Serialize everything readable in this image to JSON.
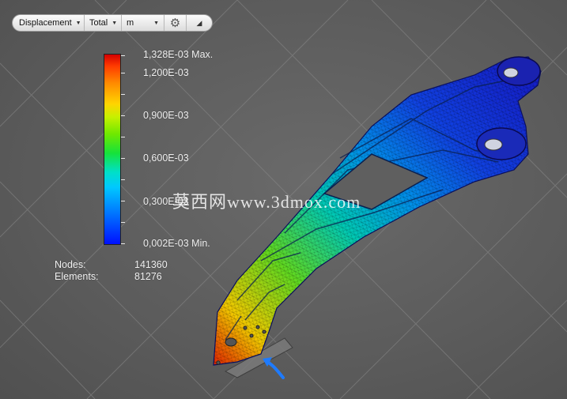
{
  "toolbar": {
    "quantity": "Displacement",
    "component": "Total",
    "unit": "m",
    "settings_icon": "gear-icon",
    "collapse_icon": "triangle-icon"
  },
  "legend": {
    "max_label": "1,328E-03 Max.",
    "ticks": [
      "1,200E-03",
      "0,900E-03",
      "0,600E-03",
      "0,300E-03"
    ],
    "min_label": "0,002E-03 Min.",
    "colors": [
      "#d40000",
      "#ff8a00",
      "#ffd400",
      "#6fe800",
      "#00e0c8",
      "#0080ff",
      "#0010ff"
    ]
  },
  "stats": {
    "nodes_label": "Nodes:",
    "nodes_value": "141360",
    "elements_label": "Elements:",
    "elements_value": "81276"
  },
  "watermark": "莫西网www.3dmox.com",
  "load_arrow_color": "#1e7bff"
}
